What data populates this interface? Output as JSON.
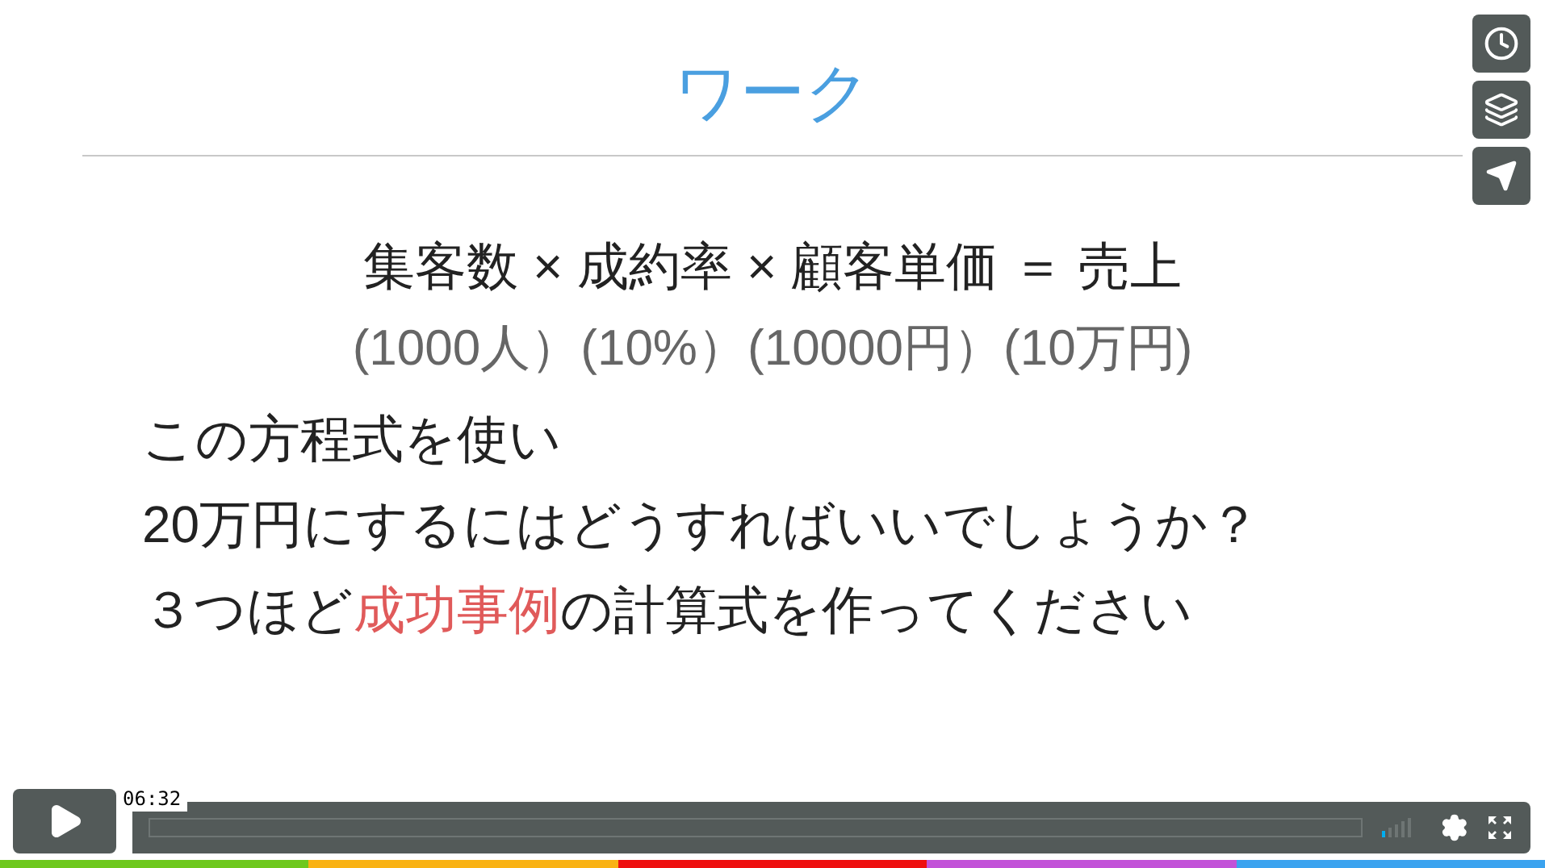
{
  "slide": {
    "title": "ワーク",
    "formula": "集客数 × 成約率 × 顧客単価 ＝ 売上",
    "example": "(1000人）(10%）(10000円）(10万円)",
    "lines": [
      [
        {
          "text": "この方程式を使い",
          "highlight": false
        }
      ],
      [
        {
          "text": "20万円にするにはどうすればいいでしょうか？",
          "highlight": false
        }
      ],
      [
        {
          "text": "３つほど",
          "highlight": false
        },
        {
          "text": "成功事例",
          "highlight": true
        },
        {
          "text": "の計算式を作ってください",
          "highlight": false
        }
      ]
    ]
  },
  "player": {
    "time": "06:32",
    "volume": {
      "level": 0.2
    }
  }
}
